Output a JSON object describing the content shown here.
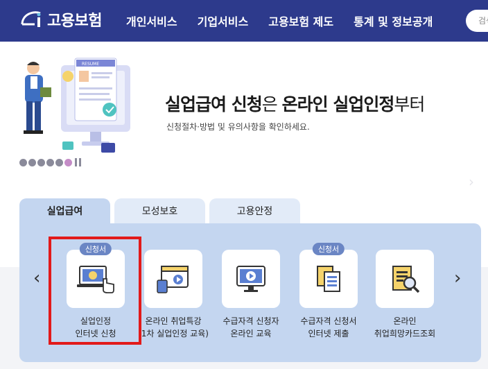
{
  "header": {
    "logo_text": "고용보험",
    "nav": [
      "개인서비스",
      "기업서비스",
      "고용보험 제도",
      "통계 및 정보공개"
    ],
    "search_placeholder": "검색"
  },
  "hero": {
    "title_bold_1": "실업급여 신청",
    "title_light_1": "은 ",
    "title_bold_2": "온라인 실업인정",
    "title_light_2": "부터",
    "subtitle": "신청절차·방법 및 유의사항을 확인하세요.",
    "illustration_label": "RESUME",
    "slide_count": 6,
    "active_slide": 6
  },
  "tabs": [
    {
      "label": "실업급여",
      "active": true
    },
    {
      "label": "모성보호",
      "active": false
    },
    {
      "label": "고용안정",
      "active": false
    }
  ],
  "services": [
    {
      "badge": "신청서",
      "line1": "실업인정",
      "line2": "인터넷 신청",
      "icon": "laptop-click-icon"
    },
    {
      "badge": "",
      "line1": "온라인 취업특강",
      "line2": "(1차 실업인정 교육)",
      "icon": "video-lecture-icon"
    },
    {
      "badge": "",
      "line1": "수급자격 신청자",
      "line2": "온라인 교육",
      "icon": "monitor-play-icon"
    },
    {
      "badge": "신청서",
      "line1": "수급자격 신청서",
      "line2": "인터넷 제출",
      "icon": "documents-icon"
    },
    {
      "badge": "",
      "line1": "온라인",
      "line2": "취업희망카드조회",
      "icon": "document-search-icon"
    }
  ],
  "colors": {
    "header_bg": "#2d3a8c",
    "panel_bg": "#c4d6f0",
    "badge_bg": "#6b86c4",
    "highlight": "#e21a1a"
  }
}
